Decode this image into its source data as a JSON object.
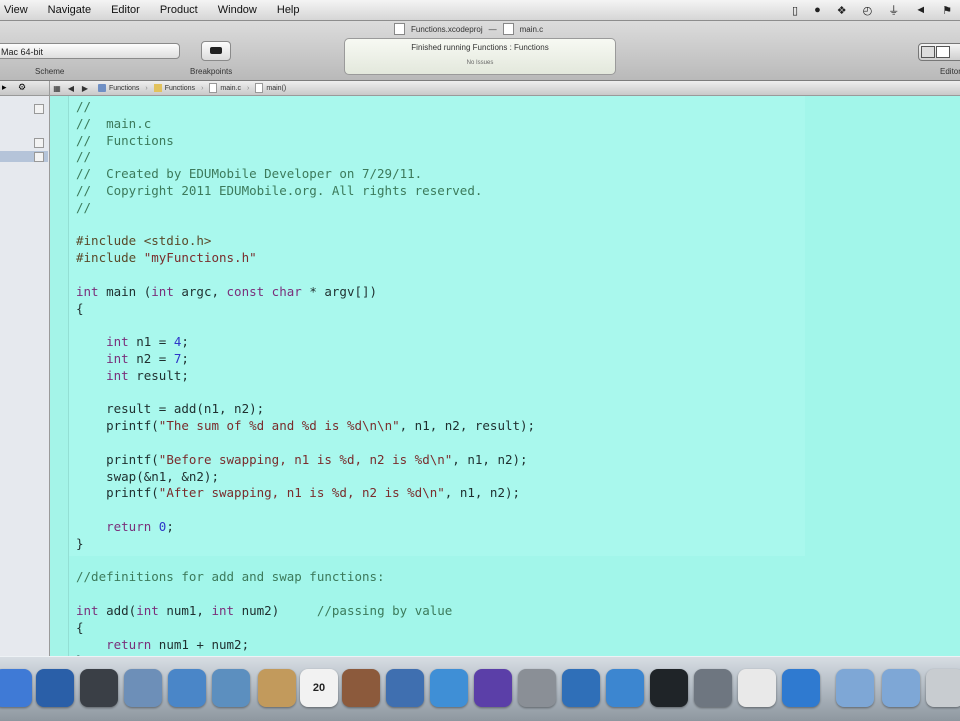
{
  "menubar": {
    "items": [
      "View",
      "Navigate",
      "Editor",
      "Product",
      "Window",
      "Help"
    ],
    "status_icons": [
      "phone-icon",
      "record-icon",
      "bluetooth-icon",
      "timemachine-icon",
      "wifi-icon",
      "volume-icon",
      "flag-icon"
    ]
  },
  "window": {
    "project_file": "Functions.xcodeproj",
    "editor_file": "main.c"
  },
  "toolbar": {
    "scheme_value": "Mac 64-bit",
    "scheme_label": "Scheme",
    "breakpoints_label": "Breakpoints",
    "editor_label": "Editor",
    "activity_message": "Finished running Functions : Functions",
    "activity_sub": "No Issues"
  },
  "jumpbar": {
    "crumbs": [
      "Functions",
      "Functions",
      "main.c",
      "main()"
    ]
  },
  "code": {
    "lines": [
      [
        [
          "c-com",
          "//"
        ]
      ],
      [
        [
          "c-com",
          "//  main.c"
        ]
      ],
      [
        [
          "c-com",
          "//  Functions"
        ]
      ],
      [
        [
          "c-com",
          "//"
        ]
      ],
      [
        [
          "c-com",
          "//  Created by EDUMobile Developer on 7/29/11."
        ]
      ],
      [
        [
          "c-com",
          "//  Copyright 2011 EDUMobile.org. All rights reserved."
        ]
      ],
      [
        [
          "c-com",
          "//"
        ]
      ],
      [],
      [
        [
          "c-pre",
          "#include <stdio.h>"
        ]
      ],
      [
        [
          "c-pre",
          "#include "
        ],
        [
          "c-str",
          "\"myFunctions.h\""
        ]
      ],
      [],
      [
        [
          "c-kw",
          "int"
        ],
        [
          "",
          " main ("
        ],
        [
          "c-kw",
          "int"
        ],
        [
          "",
          " argc, "
        ],
        [
          "c-kw",
          "const char"
        ],
        [
          "",
          " * argv[])"
        ]
      ],
      [
        [
          "",
          "{"
        ]
      ],
      [],
      [
        [
          "",
          "    "
        ],
        [
          "c-kw",
          "int"
        ],
        [
          "",
          " n1 = "
        ],
        [
          "c-num",
          "4"
        ],
        [
          "",
          ";"
        ]
      ],
      [
        [
          "",
          "    "
        ],
        [
          "c-kw",
          "int"
        ],
        [
          "",
          " n2 = "
        ],
        [
          "c-num",
          "7"
        ],
        [
          "",
          ";"
        ]
      ],
      [
        [
          "",
          "    "
        ],
        [
          "c-kw",
          "int"
        ],
        [
          "",
          " result;"
        ]
      ],
      [],
      [
        [
          "",
          "    result = add(n1, n2);"
        ]
      ],
      [
        [
          "",
          "    printf("
        ],
        [
          "c-str",
          "\"The sum of %d and %d is %d\\n\\n\""
        ],
        [
          "",
          ", n1, n2, result);"
        ]
      ],
      [],
      [
        [
          "",
          "    printf("
        ],
        [
          "c-str",
          "\"Before swapping, n1 is %d, n2 is %d\\n\""
        ],
        [
          "",
          ", n1, n2);"
        ]
      ],
      [
        [
          "",
          "    swap(&n1, &n2);"
        ]
      ],
      [
        [
          "",
          "    printf("
        ],
        [
          "c-str",
          "\"After swapping, n1 is %d, n2 is %d\\n\""
        ],
        [
          "",
          ", n1, n2);"
        ]
      ],
      [],
      [
        [
          "",
          "    "
        ],
        [
          "c-kw",
          "return"
        ],
        [
          "",
          " "
        ],
        [
          "c-num",
          "0"
        ],
        [
          "",
          ";"
        ]
      ],
      [
        [
          "",
          "}"
        ]
      ],
      [],
      [
        [
          "c-com",
          "//definitions for add and swap functions:"
        ]
      ],
      [],
      [
        [
          "c-kw",
          "int"
        ],
        [
          "",
          " add("
        ],
        [
          "c-kw",
          "int"
        ],
        [
          "",
          " num1, "
        ],
        [
          "c-kw",
          "int"
        ],
        [
          "",
          " num2)     "
        ],
        [
          "c-com",
          "//passing by value"
        ]
      ],
      [
        [
          "",
          "{"
        ]
      ],
      [
        [
          "",
          "    "
        ],
        [
          "c-kw",
          "return"
        ],
        [
          "",
          " num1 + num2;"
        ]
      ],
      [
        [
          "",
          "}"
        ]
      ]
    ]
  },
  "dock": {
    "icons": [
      {
        "name": "finder-icon",
        "color": "#3f7ad6"
      },
      {
        "name": "dashboard-icon",
        "color": "#2a5fa8"
      },
      {
        "name": "mission-control-icon",
        "color": "#3a3f46"
      },
      {
        "name": "preview-icon",
        "color": "#6d8fb8"
      },
      {
        "name": "safari-icon",
        "color": "#4a86c8"
      },
      {
        "name": "facetime-icon",
        "color": "#5c8fbf"
      },
      {
        "name": "notes-icon",
        "color": "#c29a5c"
      },
      {
        "name": "calendar-icon",
        "color": "#f2f2f2",
        "text": "20"
      },
      {
        "name": "photo-booth-icon",
        "color": "#8c5a3c"
      },
      {
        "name": "xcode-icon",
        "color": "#3f6fb0"
      },
      {
        "name": "itunes-icon",
        "color": "#3f8fd6"
      },
      {
        "name": "instruments-icon",
        "color": "#5b3fa8"
      },
      {
        "name": "system-preferences-icon",
        "color": "#8a8f96"
      },
      {
        "name": "filmstrip-icon",
        "color": "#2f6fb8"
      },
      {
        "name": "mail-icon",
        "color": "#3c86d0"
      },
      {
        "name": "terminal-icon",
        "color": "#1f2428"
      },
      {
        "name": "utility-icon",
        "color": "#6e7680"
      },
      {
        "name": "textedit-icon",
        "color": "#e9e9e9"
      },
      {
        "name": "update-icon",
        "color": "#2f7ad0"
      },
      {
        "name": "folder-icon",
        "color": "#7ea7d6"
      },
      {
        "name": "downloads-folder-icon",
        "color": "#7ea7d6"
      },
      {
        "name": "trash-icon",
        "color": "#c8ccd0"
      }
    ]
  }
}
